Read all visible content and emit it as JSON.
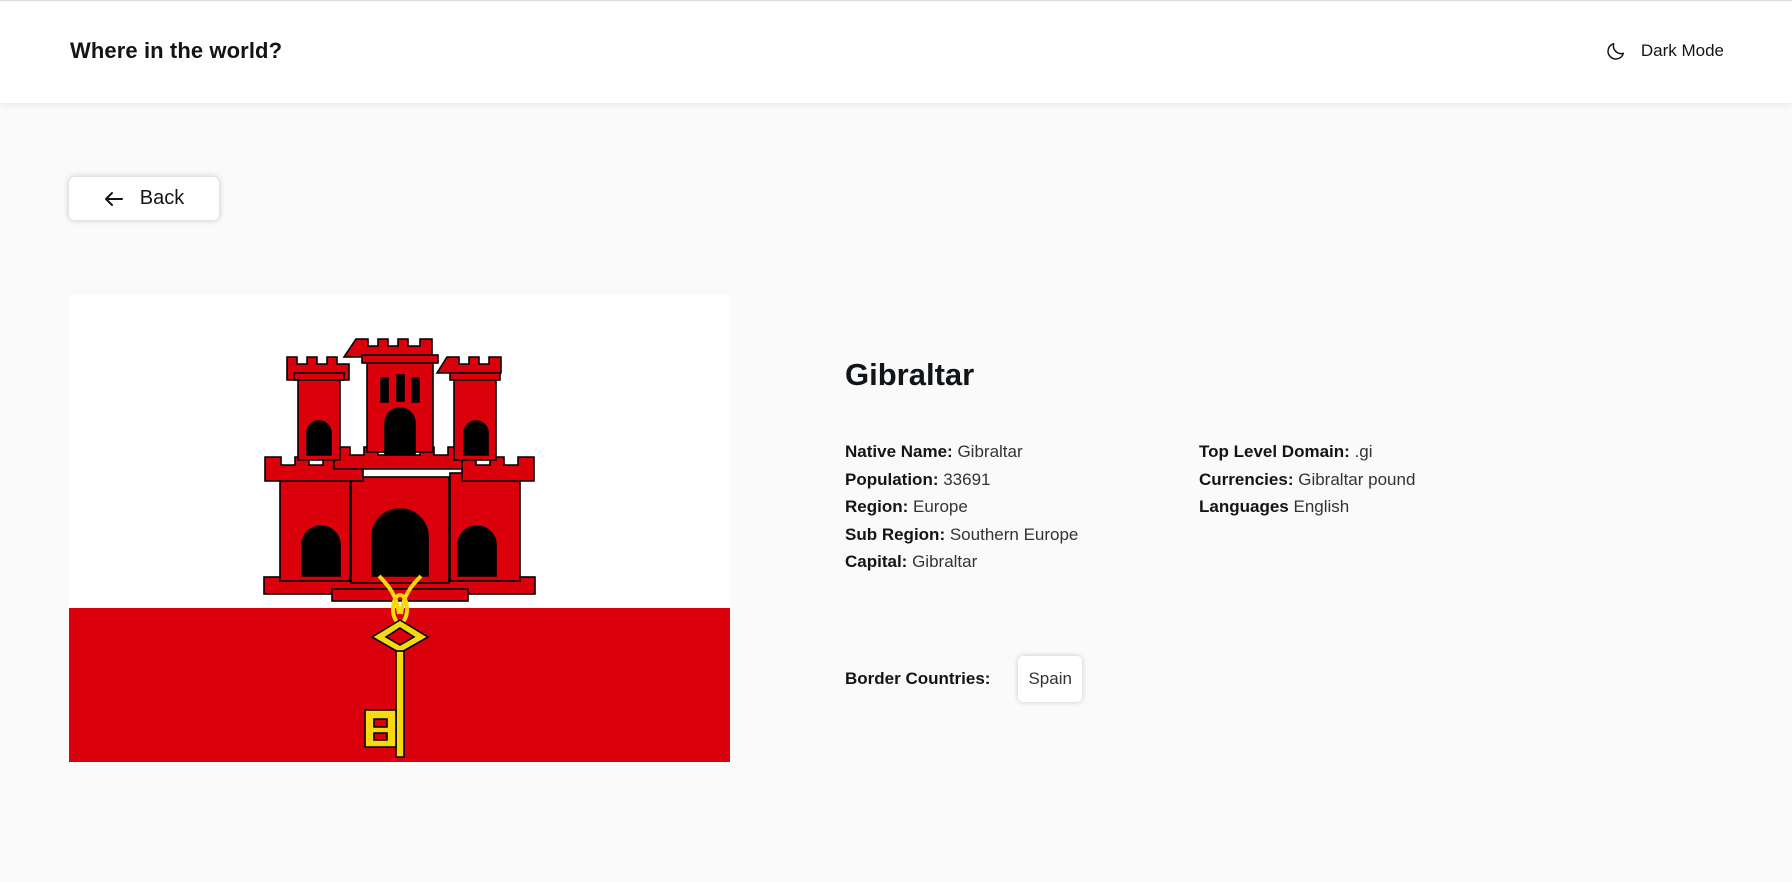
{
  "header": {
    "title": "Where in the world?",
    "theme_toggle_label": "Dark Mode",
    "theme_icon": "moon-icon"
  },
  "back_button": {
    "label": "Back",
    "icon": "arrow-left-icon"
  },
  "country": {
    "name": "Gibraltar",
    "flag": {
      "description_icon": "gibraltar-flag",
      "colors": {
        "white": "#ffffff",
        "red": "#da000c",
        "gold": "#f8d80e",
        "black": "#000000"
      }
    },
    "left_info": [
      {
        "label": "Native Name:",
        "value": "Gibraltar"
      },
      {
        "label": "Population:",
        "value": "33691"
      },
      {
        "label": "Region:",
        "value": "Europe"
      },
      {
        "label": "Sub Region:",
        "value": "Southern Europe"
      },
      {
        "label": "Capital:",
        "value": "Gibraltar"
      }
    ],
    "right_info": [
      {
        "label": "Top Level Domain:",
        "value": ".gi"
      },
      {
        "label": "Currencies:",
        "value": "Gibraltar pound"
      },
      {
        "label": "Languages",
        "value": "English"
      }
    ],
    "borders_label": "Border Countries:",
    "borders": [
      "Spain"
    ]
  },
  "colors": {
    "background": "#fafafa",
    "surface": "#ffffff",
    "text": "#111517"
  }
}
